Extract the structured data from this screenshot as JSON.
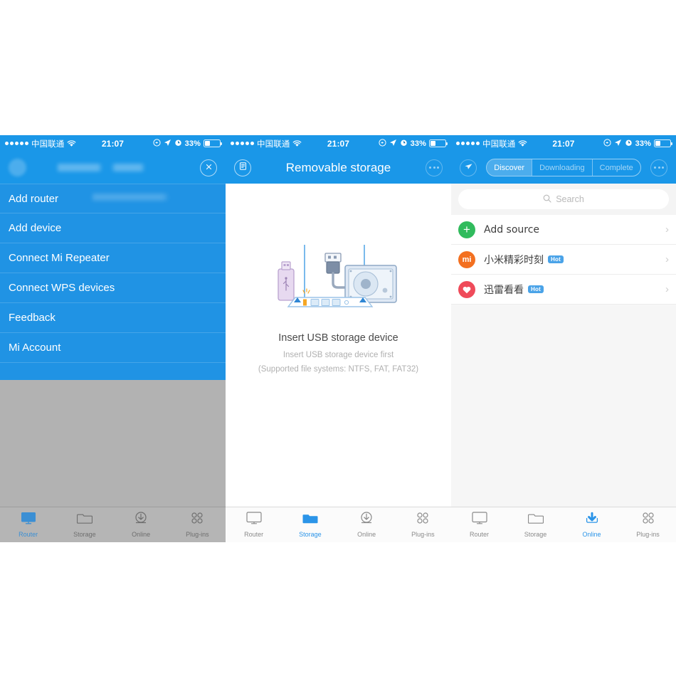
{
  "status_bar": {
    "carrier": "中国联通",
    "signal_dots": 5,
    "wifi_icon": "wifi-icon",
    "time": "21:07",
    "rotation_lock_icon": "rotation-lock-icon",
    "location_icon": "location-arrow-icon",
    "alarm_icon": "alarm-clock-icon",
    "battery_percent": "33%",
    "battery_level": 33
  },
  "colors": {
    "brand_blue": "#1a97e8",
    "drawer_blue": "#2093e4",
    "accent_blue": "#2b94e8",
    "overlay_gray": "#b2b2b2",
    "list_bg": "#f6f6f6",
    "green": "#31bb5d",
    "orange": "#f37020",
    "red": "#ef4b5a",
    "hot_badge": "#4aa3e8"
  },
  "panel_router": {
    "navbar": {
      "avatar": "avatar-blurred",
      "title_obscured": "",
      "close_label": "✕"
    },
    "drawer_items": [
      {
        "label": "Add router"
      },
      {
        "label": "Add device"
      },
      {
        "label": "Connect Mi Repeater"
      },
      {
        "label": "Connect WPS devices"
      },
      {
        "label": "Feedback"
      },
      {
        "label": "Mi Account"
      }
    ],
    "tabs": [
      {
        "label": "Router",
        "icon": "monitor-icon",
        "active": true
      },
      {
        "label": "Storage",
        "icon": "folder-icon",
        "active": false
      },
      {
        "label": "Online",
        "icon": "download-icon",
        "active": false
      },
      {
        "label": "Plug-ins",
        "icon": "grid-dots-icon",
        "active": false
      }
    ]
  },
  "panel_storage": {
    "navbar": {
      "left_icon": "list-document-icon",
      "title": "Removable storage",
      "more_icon": "more-dots-icon"
    },
    "empty_state": {
      "illustration": "usb-storage-illustration",
      "title": "Insert USB storage device",
      "subtitle": "Insert USB storage device first",
      "note": "(Supported file systems: NTFS, FAT, FAT32)"
    },
    "tabs": [
      {
        "label": "Router",
        "icon": "monitor-icon",
        "active": false
      },
      {
        "label": "Storage",
        "icon": "folder-icon",
        "active": true
      },
      {
        "label": "Online",
        "icon": "download-icon",
        "active": false
      },
      {
        "label": "Plug-ins",
        "icon": "grid-dots-icon",
        "active": false
      }
    ]
  },
  "panel_online": {
    "navbar": {
      "left_icon": "send-plane-icon",
      "more_icon": "more-dots-icon",
      "segments": [
        {
          "label": "Discover",
          "active": true
        },
        {
          "label": "Downloading",
          "active": false
        },
        {
          "label": "Complete",
          "active": false
        }
      ]
    },
    "search": {
      "placeholder": "Search",
      "value": "",
      "icon": "search-icon"
    },
    "list": [
      {
        "label": "Add source",
        "avatar": "plus-icon",
        "avatar_color": "green",
        "badge": ""
      },
      {
        "label": "小米精彩时刻",
        "avatar": "mi-logo-icon",
        "avatar_color": "orange",
        "badge": "Hot"
      },
      {
        "label": "迅雷看看",
        "avatar": "xunlei-icon",
        "avatar_color": "red",
        "badge": "Hot"
      }
    ],
    "tabs": [
      {
        "label": "Router",
        "icon": "monitor-icon",
        "active": false
      },
      {
        "label": "Storage",
        "icon": "folder-icon",
        "active": false
      },
      {
        "label": "Online",
        "icon": "download-icon",
        "active": true
      },
      {
        "label": "Plug-ins",
        "icon": "grid-dots-icon",
        "active": false
      }
    ]
  }
}
